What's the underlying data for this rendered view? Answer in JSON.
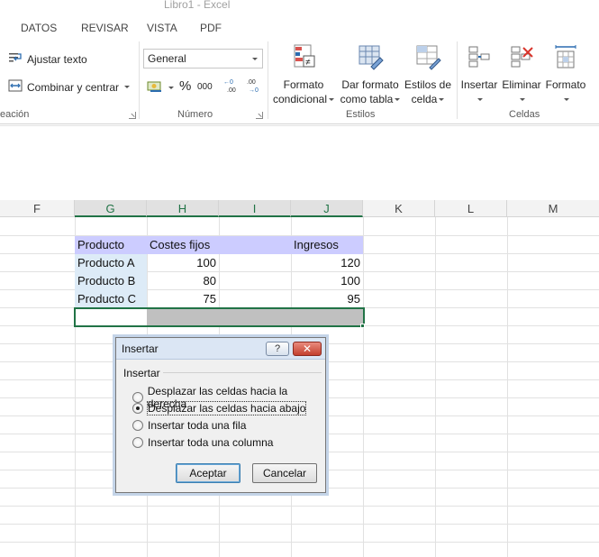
{
  "window": {
    "title": "Libro1 - Excel"
  },
  "tabs": [
    "DATOS",
    "REVISAR",
    "VISTA",
    "PDF"
  ],
  "ribbon": {
    "alignment": {
      "group_label": "eación",
      "wrap_text": "Ajustar texto",
      "merge_center": "Combinar y centrar"
    },
    "number": {
      "group_label": "Número",
      "format_value": "General",
      "percent": "%",
      "thousands": "000",
      "inc_decimal": "←0 .00",
      "dec_decimal": ".00 →0"
    },
    "styles": {
      "group_label": "Estilos",
      "conditional_l1": "Formato",
      "conditional_l2": "condicional",
      "table_l1": "Dar formato",
      "table_l2": "como tabla",
      "cell_l1": "Estilos de",
      "cell_l2": "celda"
    },
    "cells": {
      "group_label": "Celdas",
      "insert": "Insertar",
      "delete": "Eliminar",
      "format": "Formato"
    }
  },
  "grid": {
    "columns": [
      "F",
      "G",
      "H",
      "I",
      "J",
      "K",
      "L",
      "M"
    ],
    "selected_columns": [
      "G",
      "H",
      "I",
      "J"
    ],
    "header_row": {
      "G": "Producto",
      "H": "Costes fijos",
      "J": "Ingresos"
    },
    "rows": [
      {
        "G": "Producto A",
        "H": "100",
        "J": "120"
      },
      {
        "G": "Producto B",
        "H": "80",
        "J": "100"
      },
      {
        "G": "Producto C",
        "H": "75",
        "J": "95"
      }
    ]
  },
  "dialog": {
    "title": "Insertar",
    "help": "?",
    "close": "✕",
    "group_label": "Insertar",
    "options": [
      {
        "label": "Desplazar las celdas hacia la derecha",
        "selected": false
      },
      {
        "label": "Desplazar las celdas hacia abajo",
        "selected": true
      },
      {
        "label": "Insertar toda una fila",
        "selected": false
      },
      {
        "label": "Insertar toda una columna",
        "selected": false
      }
    ],
    "ok": "Aceptar",
    "cancel": "Cancelar"
  },
  "colors": {
    "excel_green": "#217346",
    "header_fill": "#ccccff",
    "product_fill": "#ddebf7",
    "selection_fill": "#c0c0c0"
  }
}
